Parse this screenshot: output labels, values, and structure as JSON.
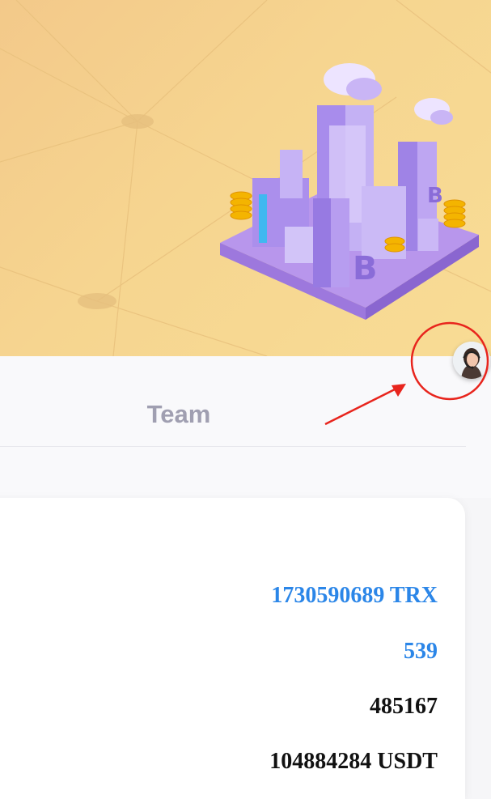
{
  "tabs": {
    "team_label": "Team"
  },
  "stats": {
    "trx_value": "1730590689 TRX",
    "count_value": "539",
    "members_value": "485167",
    "usdt_value": "104884284 USDT"
  },
  "icons": {
    "banner": "city-buildings-illustration",
    "support": "customer-support-agent-icon",
    "highlight": "red-circle-annotation",
    "pointer": "red-arrow-annotation"
  },
  "colors": {
    "banner_bg": "#f5d08e",
    "tab_inactive": "#a09fb1",
    "value_blue": "#2b86e8",
    "value_dark": "#111111",
    "annotation_red": "#e8251d"
  }
}
